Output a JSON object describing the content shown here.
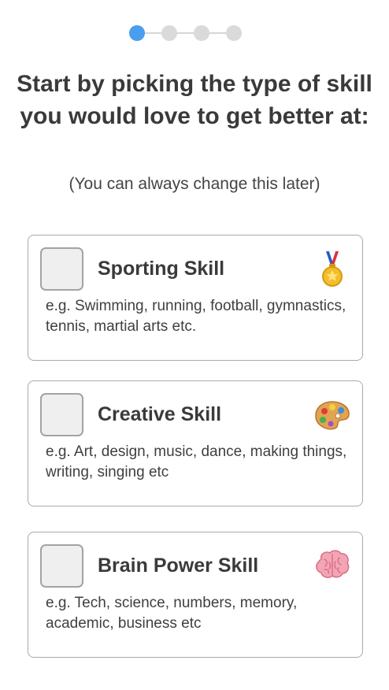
{
  "stepper": {
    "total_steps": 4,
    "current_step": 1,
    "active_color": "#4a9ef0",
    "inactive_color": "#dadada"
  },
  "header": {
    "title": "Start by picking the type of skill you would love to get better at:",
    "subtitle": "(You can always change this later)"
  },
  "skills": [
    {
      "title": "Sporting Skill",
      "description": "e.g. Swimming, running, football, gymnastics, tennis, martial arts etc.",
      "icon": "medal-icon",
      "checked": false
    },
    {
      "title": "Creative Skill",
      "description": "e.g. Art, design, music, dance, making things, writing, singing etc",
      "icon": "palette-icon",
      "checked": false
    },
    {
      "title": "Brain Power Skill",
      "description": "e.g. Tech, science, numbers, memory, academic, business etc",
      "icon": "brain-icon",
      "checked": false
    }
  ]
}
